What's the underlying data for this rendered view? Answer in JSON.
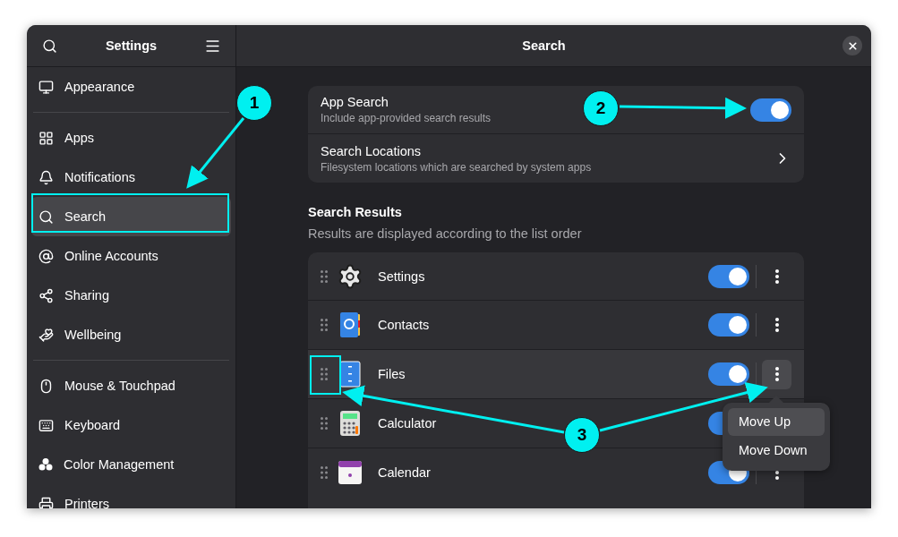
{
  "window": {
    "sidebar_title": "Settings",
    "title": "Search"
  },
  "sidebar": {
    "sections": [
      {
        "items": [
          {
            "label": "Appearance",
            "selected": false
          }
        ]
      },
      {
        "items": [
          {
            "label": "Apps",
            "selected": false
          },
          {
            "label": "Notifications",
            "selected": false
          },
          {
            "label": "Search",
            "selected": true
          },
          {
            "label": "Online Accounts",
            "selected": false
          },
          {
            "label": "Sharing",
            "selected": false
          },
          {
            "label": "Wellbeing",
            "selected": false
          }
        ]
      },
      {
        "items": [
          {
            "label": "Mouse & Touchpad",
            "selected": false
          },
          {
            "label": "Keyboard",
            "selected": false
          },
          {
            "label": "Color Management",
            "selected": false
          },
          {
            "label": "Printers",
            "selected": false
          }
        ]
      }
    ]
  },
  "general": {
    "rows": [
      {
        "kind": "switch",
        "title": "App Search",
        "subtitle": "Include app-provided search results",
        "on": true
      },
      {
        "kind": "link",
        "title": "Search Locations",
        "subtitle": "Filesystem locations which are searched by system apps"
      }
    ]
  },
  "search_results": {
    "heading": "Search Results",
    "description": "Results are displayed according to the list order",
    "rows": [
      {
        "name": "Settings",
        "on": true,
        "menu_open": false
      },
      {
        "name": "Contacts",
        "on": true,
        "menu_open": false
      },
      {
        "name": "Files",
        "on": true,
        "menu_open": true
      },
      {
        "name": "Calculator",
        "on": true,
        "menu_open": false
      },
      {
        "name": "Calendar",
        "on": true,
        "menu_open": false
      }
    ]
  },
  "row_menu": {
    "items": [
      {
        "label": "Move Up",
        "selected": true
      },
      {
        "label": "Move Down",
        "selected": false
      }
    ]
  },
  "annotations": [
    {
      "label": "1"
    },
    {
      "label": "2"
    },
    {
      "label": "3"
    }
  ]
}
